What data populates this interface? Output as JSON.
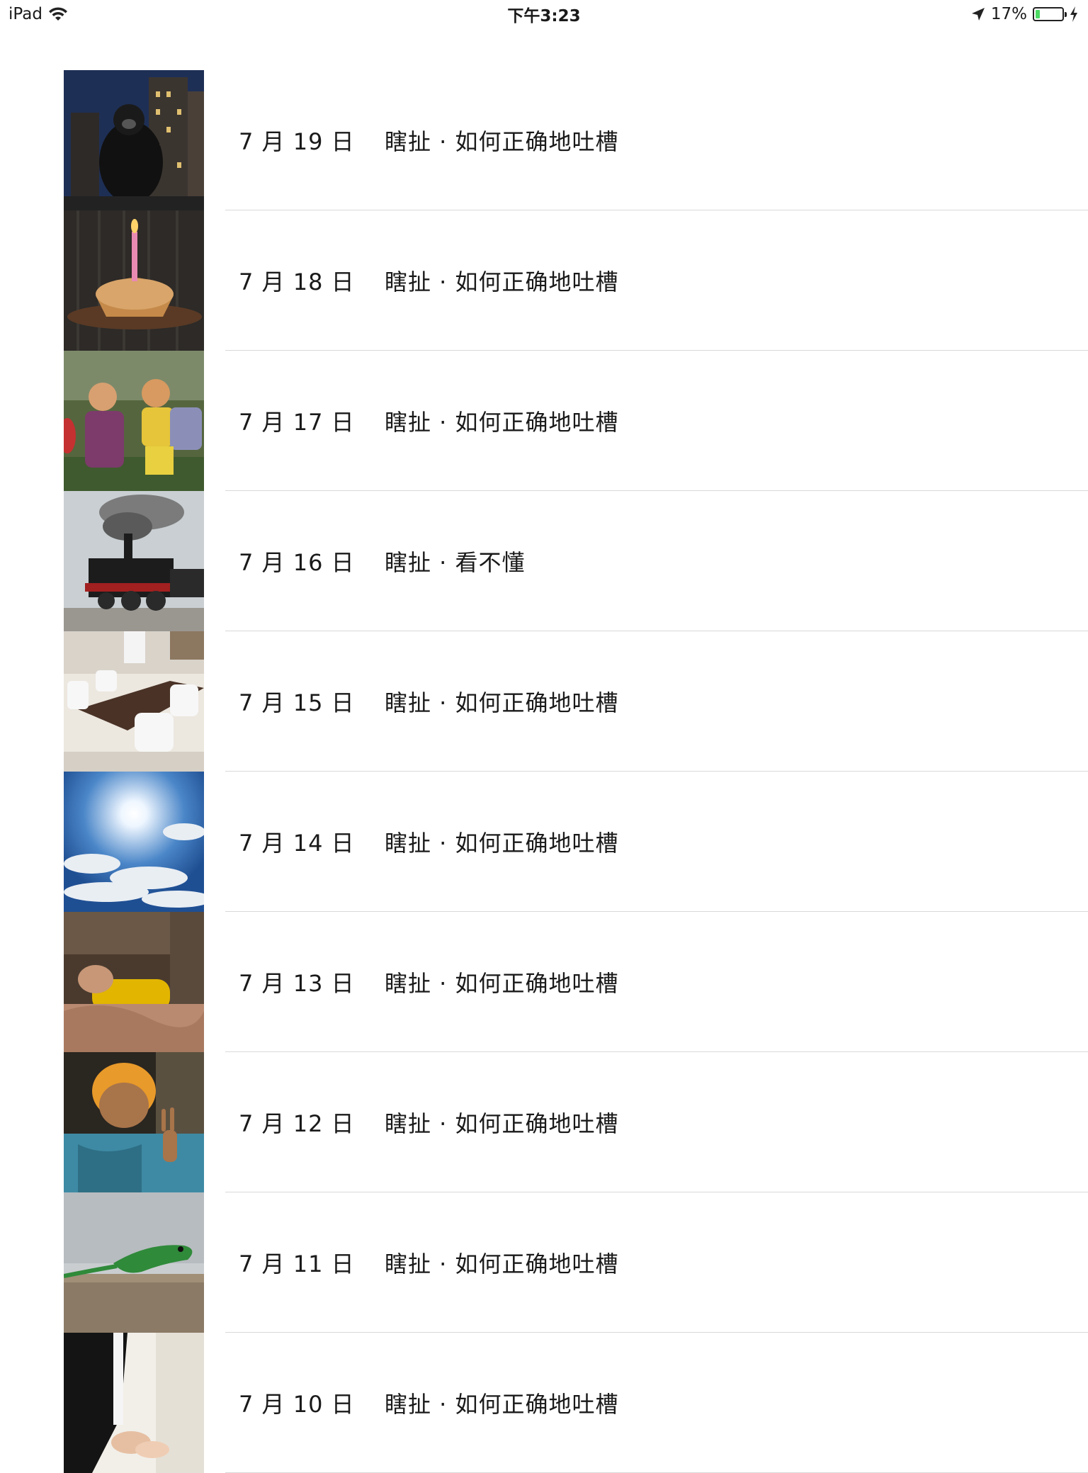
{
  "status_bar": {
    "device": "iPad",
    "time": "下午3:23",
    "battery_text": "17%",
    "battery_level": 0.17,
    "battery_color": "#4cd964"
  },
  "list": {
    "items": [
      {
        "date": "7 月 19 日",
        "title": "瞎扯 · 如何正确地吐槽",
        "thumb": "gorilla-city-night"
      },
      {
        "date": "7 月 18 日",
        "title": "瞎扯 · 如何正确地吐槽",
        "thumb": "birthday-cupcake-candle"
      },
      {
        "date": "7 月 17 日",
        "title": "瞎扯 · 如何正确地吐槽",
        "thumb": "monkey-king-costumes"
      },
      {
        "date": "7 月 16 日",
        "title": "瞎扯 · 看不懂",
        "thumb": "steam-locomotive"
      },
      {
        "date": "7 月 15 日",
        "title": "瞎扯 · 如何正确地吐槽",
        "thumb": "conference-room"
      },
      {
        "date": "7 月 14 日",
        "title": "瞎扯 · 如何正确地吐槽",
        "thumb": "sun-clouds-sky"
      },
      {
        "date": "7 月 13 日",
        "title": "瞎扯 · 如何正确地吐槽",
        "thumb": "man-lying-bed"
      },
      {
        "date": "7 月 12 日",
        "title": "瞎扯 · 如何正确地吐槽",
        "thumb": "man-peace-sign"
      },
      {
        "date": "7 月 11 日",
        "title": "瞎扯 · 如何正确地吐槽",
        "thumb": "green-lizard"
      },
      {
        "date": "7 月 10 日",
        "title": "瞎扯 · 如何正确地吐槽",
        "thumb": "wedding-hands"
      }
    ]
  }
}
